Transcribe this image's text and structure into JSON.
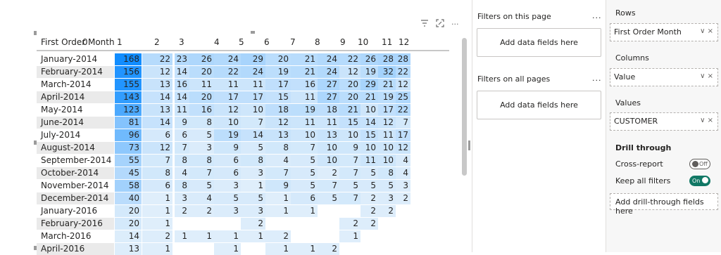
{
  "visual_toolbar": {
    "filter_icon": "filter-icon",
    "focus_icon": "focus-mode-icon",
    "more_label": "···"
  },
  "matrix": {
    "row_header": "First Order Month",
    "columns": [
      "0",
      "1",
      "2",
      "3",
      "4",
      "5",
      "6",
      "7",
      "8",
      "9",
      "10",
      "11",
      "12"
    ],
    "rows": [
      {
        "label": "January-2014",
        "values": [
          "168",
          "22",
          "23",
          "26",
          "24",
          "29",
          "20",
          "21",
          "24",
          "22",
          "26",
          "28",
          "28"
        ]
      },
      {
        "label": "February-2014",
        "values": [
          "156",
          "12",
          "14",
          "20",
          "22",
          "24",
          "19",
          "21",
          "24",
          "12",
          "19",
          "32",
          "22"
        ]
      },
      {
        "label": "March-2014",
        "values": [
          "155",
          "13",
          "16",
          "11",
          "11",
          "11",
          "17",
          "16",
          "27",
          "20",
          "29",
          "21",
          "12"
        ]
      },
      {
        "label": "April-2014",
        "values": [
          "143",
          "14",
          "14",
          "20",
          "17",
          "17",
          "15",
          "11",
          "27",
          "20",
          "21",
          "19",
          "25"
        ]
      },
      {
        "label": "May-2014",
        "values": [
          "123",
          "13",
          "11",
          "16",
          "12",
          "10",
          "18",
          "19",
          "18",
          "21",
          "10",
          "17",
          "22"
        ]
      },
      {
        "label": "June-2014",
        "values": [
          "81",
          "14",
          "9",
          "8",
          "10",
          "7",
          "12",
          "11",
          "11",
          "15",
          "14",
          "12",
          "7"
        ]
      },
      {
        "label": "July-2014",
        "values": [
          "96",
          "6",
          "6",
          "5",
          "19",
          "14",
          "13",
          "10",
          "13",
          "10",
          "15",
          "11",
          "17"
        ]
      },
      {
        "label": "August-2014",
        "values": [
          "73",
          "12",
          "7",
          "3",
          "9",
          "5",
          "8",
          "7",
          "10",
          "9",
          "10",
          "10",
          "12"
        ]
      },
      {
        "label": "September-2014",
        "values": [
          "55",
          "7",
          "8",
          "8",
          "6",
          "8",
          "4",
          "5",
          "10",
          "7",
          "11",
          "10",
          "4"
        ]
      },
      {
        "label": "October-2014",
        "values": [
          "45",
          "8",
          "4",
          "7",
          "6",
          "3",
          "7",
          "5",
          "2",
          "7",
          "5",
          "8",
          "4"
        ]
      },
      {
        "label": "November-2014",
        "values": [
          "58",
          "6",
          "8",
          "5",
          "3",
          "1",
          "9",
          "5",
          "7",
          "5",
          "5",
          "5",
          "3"
        ]
      },
      {
        "label": "December-2014",
        "values": [
          "40",
          "1",
          "3",
          "4",
          "5",
          "5",
          "1",
          "6",
          "5",
          "7",
          "2",
          "3",
          "2"
        ]
      },
      {
        "label": "January-2016",
        "values": [
          "20",
          "1",
          "2",
          "2",
          "3",
          "3",
          "1",
          "1",
          "",
          "",
          "2",
          "2",
          ""
        ]
      },
      {
        "label": "February-2016",
        "values": [
          "20",
          "1",
          "",
          "",
          "",
          "2",
          "",
          "",
          "",
          "2",
          "2",
          "",
          ""
        ]
      },
      {
        "label": "March-2016",
        "values": [
          "14",
          "2",
          "1",
          "1",
          "1",
          "1",
          "2",
          "",
          "",
          "1",
          "",
          "",
          ""
        ]
      },
      {
        "label": "April-2016",
        "values": [
          "13",
          "1",
          "",
          "",
          "1",
          "",
          "1",
          "1",
          "2",
          "",
          "",
          "",
          ""
        ]
      }
    ]
  },
  "filters": {
    "page_title": "Filters on this page",
    "page_dots": "...",
    "page_drop": "Add data fields here",
    "all_title": "Filters on all pages",
    "all_dots": "...",
    "all_drop": "Add data fields here"
  },
  "build": {
    "rows_label": "Rows",
    "rows_field": "First Order Month",
    "columns_label": "Columns",
    "columns_field": "Value",
    "values_label": "Values",
    "values_field": "CUSTOMER",
    "well_ctrl": "∨  ×",
    "drill_title": "Drill through",
    "cross_report_label": "Cross-report",
    "cross_report_state": "Off",
    "keep_filters_label": "Keep all filters",
    "keep_filters_state": "On",
    "drill_drop": "Add drill-through fields here"
  },
  "colors": {
    "accent": "#117865",
    "heat_max": "#118dff",
    "heat_min": "#e1effb"
  }
}
